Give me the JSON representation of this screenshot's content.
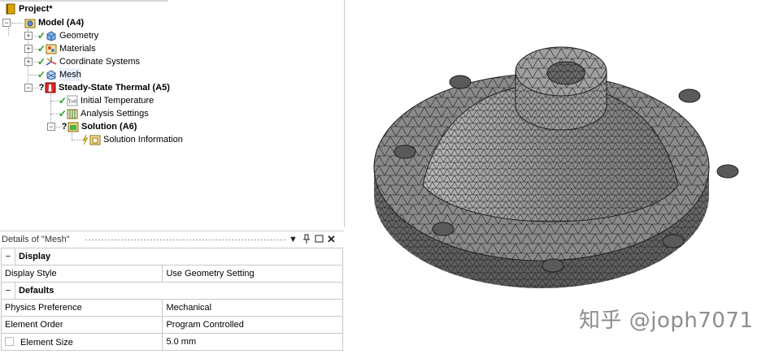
{
  "tree": {
    "project": "Project*",
    "model": "Model (A4)",
    "geometry": "Geometry",
    "materials": "Materials",
    "coordinate_systems": "Coordinate Systems",
    "mesh": "Mesh",
    "analysis": "Steady-State Thermal (A5)",
    "initial_temperature": "Initial Temperature",
    "analysis_settings": "Analysis Settings",
    "solution": "Solution (A6)",
    "solution_information": "Solution Information",
    "initial_temp_icon_text": "T=0"
  },
  "details": {
    "title": "Details of \"Mesh\"",
    "sections": [
      {
        "name": "Display",
        "rows": [
          {
            "label": "Display Style",
            "value": "Use Geometry Setting"
          }
        ]
      },
      {
        "name": "Defaults",
        "rows": [
          {
            "label": "Physics Preference",
            "value": "Mechanical"
          },
          {
            "label": "Element Order",
            "value": "Program Controlled"
          },
          {
            "label": "Element Size",
            "value": "5.0 mm"
          }
        ]
      }
    ]
  },
  "watermark": "知乎 @joph7071",
  "colors": {
    "check": "#1aa01a",
    "mesh_fill": "#8a8a8a",
    "mesh_line": "#1e1e1e"
  }
}
